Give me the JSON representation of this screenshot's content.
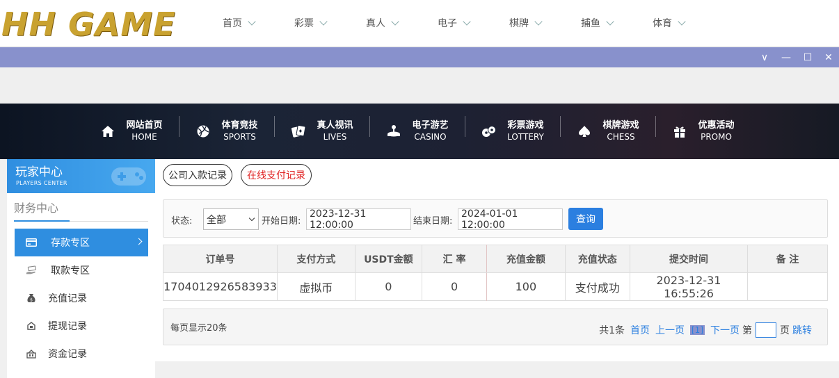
{
  "logo": {
    "text": "HH GAME"
  },
  "top_menu": [
    {
      "label": "首页"
    },
    {
      "label": "彩票"
    },
    {
      "label": "真人"
    },
    {
      "label": "电子"
    },
    {
      "label": "棋牌"
    },
    {
      "label": "捕鱼"
    },
    {
      "label": "体育"
    }
  ],
  "window_controls": {
    "collapse": "∨",
    "minimize": "—",
    "maximize": "☐",
    "close": "✕"
  },
  "game_nav": [
    {
      "cn": "网站首页",
      "en": "HOME",
      "icon": "home-icon"
    },
    {
      "cn": "体育竞技",
      "en": "SPORTS",
      "icon": "ball-icon"
    },
    {
      "cn": "真人视讯",
      "en": "LIVES",
      "icon": "cards-icon"
    },
    {
      "cn": "电子游艺",
      "en": "CASINO",
      "icon": "joystick-icon"
    },
    {
      "cn": "彩票游戏",
      "en": "LOTTERY",
      "icon": "lottery-balls-icon"
    },
    {
      "cn": "棋牌游戏",
      "en": "CHESS",
      "icon": "spade-icon"
    },
    {
      "cn": "优惠活动",
      "en": "PROMO",
      "icon": "gift-icon"
    }
  ],
  "sidebar": {
    "title": "玩家中心",
    "subtitle": "PLAYERS CENTER",
    "section": "财务中心",
    "items": [
      {
        "label": "存款专区",
        "icon": "card-icon"
      },
      {
        "label": "取款专区",
        "icon": "cash-hand-icon"
      },
      {
        "label": "充值记录",
        "icon": "money-bag-icon"
      },
      {
        "label": "提现记录",
        "icon": "withdraw-icon"
      },
      {
        "label": "资金记录",
        "icon": "funds-icon"
      }
    ]
  },
  "tabs": {
    "company": "公司入款记录",
    "online": "在线支付记录"
  },
  "filter": {
    "status_label": "状态:",
    "status_value": "全部",
    "start_label": "开始日期:",
    "start_value": "2023-12-31 12:00:00",
    "end_label": "结束日期:",
    "end_value": "2024-01-01 12:00:00",
    "search_button": "查询"
  },
  "table": {
    "headers": [
      "订单号",
      "支付方式",
      "USDT金额",
      "汇 率",
      "充值金额",
      "充值状态",
      "提交时间",
      "备 注"
    ],
    "rows": [
      [
        "1704012926583933",
        "虚拟币",
        "0",
        "0",
        "100",
        "支付成功",
        "2023-12-31 16:55:26",
        ""
      ]
    ]
  },
  "pager": {
    "per_page": "每页显示20条",
    "total": "共1条",
    "first": "首页",
    "prev": "上一页",
    "current": "[1]",
    "next": "下一页",
    "page_prefix": "第",
    "page_suffix": "页",
    "jump": "跳转"
  },
  "colors": {
    "accent": "#2f8ee0",
    "window_bar": "#8891cc",
    "button": "#2b7fe0",
    "online_tab_text": "#e02020"
  }
}
